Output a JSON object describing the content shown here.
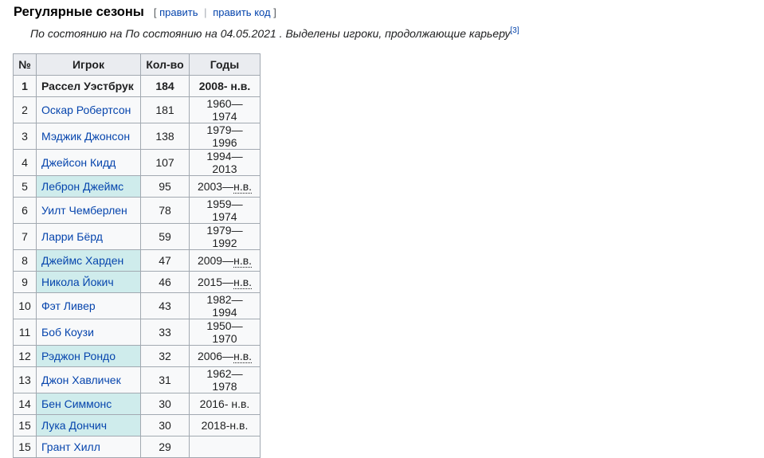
{
  "section": {
    "title": "Регулярные сезоны",
    "edit_open": "[",
    "edit_label": "править",
    "edit_code_label": "править код",
    "edit_close": "]"
  },
  "note": {
    "text": "По состоянию на По состоянию на 04.05.2021 . Выделены игроки, продолжающие карьеру",
    "ref": "[3]"
  },
  "table": {
    "headers": [
      "№",
      "Игрок",
      "Кол-во",
      "Годы"
    ],
    "rows": [
      {
        "rank": "1",
        "player": "Рассел Уэстбрук",
        "count": "184",
        "years": "2008- н.в."
      },
      {
        "rank": "2",
        "player": "Оскар Робертсон",
        "count": "181",
        "years": "1960—1974"
      },
      {
        "rank": "3",
        "player": "Мэджик Джонсон",
        "count": "138",
        "years": "1979—1996"
      },
      {
        "rank": "4",
        "player": "Джейсон Кидд",
        "count": "107",
        "years": "1994—2013"
      },
      {
        "rank": "5",
        "player": "Леброн Джеймс",
        "count": "95",
        "years_start": "2003—",
        "years_end": "н.в."
      },
      {
        "rank": "6",
        "player": "Уилт Чемберлен",
        "count": "78",
        "years": "1959—1974"
      },
      {
        "rank": "7",
        "player": "Ларри Бёрд",
        "count": "59",
        "years": "1979—1992"
      },
      {
        "rank": "8",
        "player": "Джеймс Харден",
        "count": "47",
        "years_start": "2009—",
        "years_end": "н.в."
      },
      {
        "rank": "9",
        "player": "Никола Йокич",
        "count": "46",
        "years_start": "2015—",
        "years_end": "н.в."
      },
      {
        "rank": "10",
        "player": "Фэт Ливер",
        "count": "43",
        "years": "1982—1994"
      },
      {
        "rank": "11",
        "player": "Боб Коузи",
        "count": "33",
        "years": "1950—1970"
      },
      {
        "rank": "12",
        "player": "Рэджон Рондо",
        "count": "32",
        "years_start": "2006—",
        "years_end": "н.в."
      },
      {
        "rank": "13",
        "player": "Джон Хавличек",
        "count": "31",
        "years": "1962—1978"
      },
      {
        "rank": "14",
        "player": "Бен Симмонс",
        "count": "30",
        "years": "2016- н.в."
      },
      {
        "rank": "15",
        "player": "Лука Дончич",
        "count": "30",
        "years": "2018-н.в."
      },
      {
        "rank": "15",
        "player": "Грант Хилл",
        "count": "29",
        "years": ""
      }
    ]
  },
  "colors": {
    "link": "#0645ad",
    "active_highlight": "#cfecec",
    "header_bg": "#eaecf0",
    "cell_bg": "#f8f9fa",
    "border": "#a2a9b1"
  }
}
